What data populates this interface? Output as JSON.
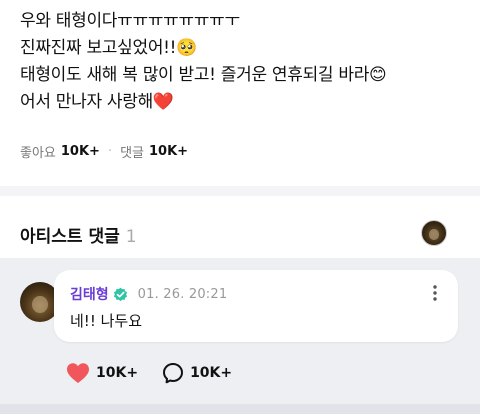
{
  "post": {
    "lines": [
      "우와 태형이다ㅠㅠㅠㅠㅠㅠㅠㅜ",
      "진짜진짜 보고싶었어!!🥺",
      "태형이도 새해 복 많이 받고! 즐거운 연휴되길 바라😊",
      "어서 만나자 사랑해❤️"
    ],
    "like_label": "좋아요",
    "like_count": "10K+",
    "reply_label": "댓글",
    "reply_count": "10K+"
  },
  "artist_section": {
    "title": "아티스트 댓글",
    "count": "1"
  },
  "comment": {
    "author": "김태형",
    "timestamp": "01. 26. 20:21",
    "text": "네!! 나두요",
    "like_count": "10K+",
    "reply_count": "10K+",
    "verified_color": "#2ec4a4",
    "author_color": "#6a3cd6",
    "heart_color": "#f0565b"
  }
}
